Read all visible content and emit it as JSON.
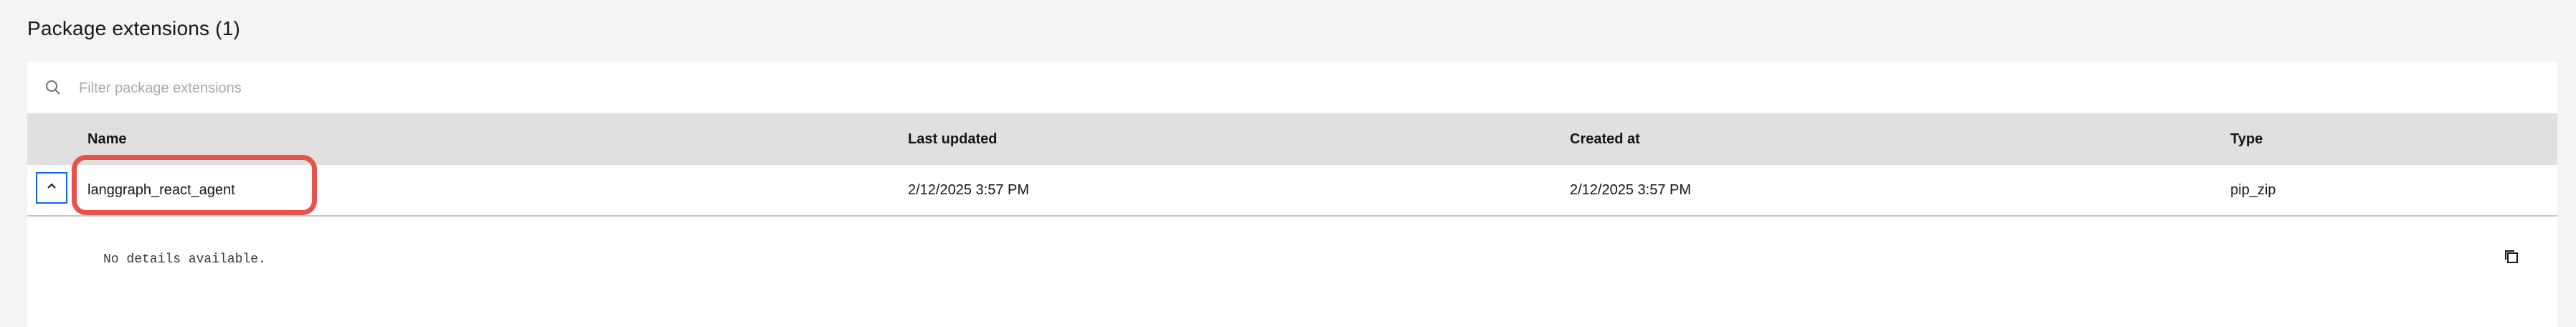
{
  "page": {
    "title": "Package extensions (1)"
  },
  "search": {
    "placeholder": "Filter package extensions",
    "value": ""
  },
  "table": {
    "headers": [
      "Name",
      "Last updated",
      "Created at",
      "Type"
    ],
    "rows": [
      {
        "name": "langgraph_react_agent",
        "last_updated": "2/12/2025 3:57 PM",
        "created_at": "2/12/2025 3:57 PM",
        "type": "pip_zip",
        "expanded": true,
        "details": "No details available."
      }
    ]
  },
  "icons": {
    "search": "search-icon",
    "expand": "chevron-up-icon",
    "copy": "copy-icon"
  },
  "colors": {
    "focus_border": "#0f62fe",
    "highlight": "#e8524a",
    "header_bg": "#e0e0e0"
  }
}
